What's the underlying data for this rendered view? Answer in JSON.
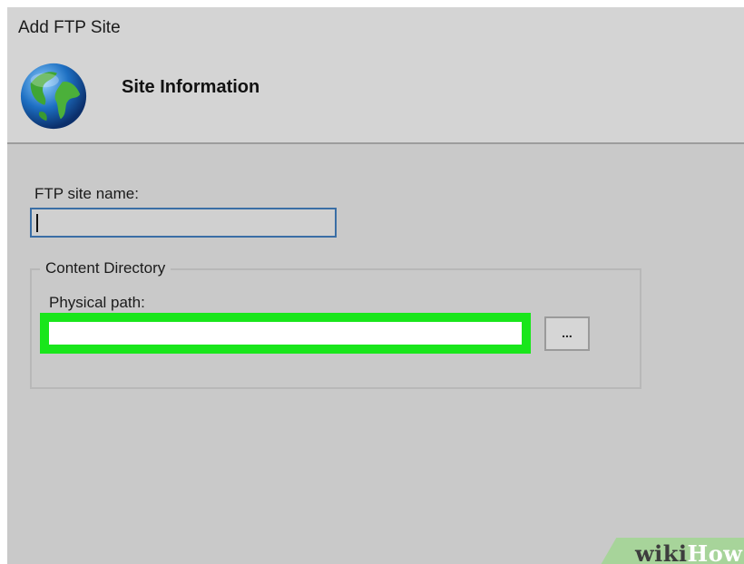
{
  "window": {
    "title": "Add FTP Site"
  },
  "header": {
    "section_title": "Site Information",
    "icon": "globe-icon"
  },
  "form": {
    "site_name_label": "FTP site name:",
    "site_name_value": "",
    "content_directory_legend": "Content Directory",
    "physical_path_label": "Physical path:",
    "physical_path_value": "",
    "browse_label": "..."
  },
  "watermark": {
    "part1": "wiki",
    "part2": "How"
  },
  "colors": {
    "highlight": "#19e61b",
    "input_focus_border": "#3a6ea5"
  }
}
